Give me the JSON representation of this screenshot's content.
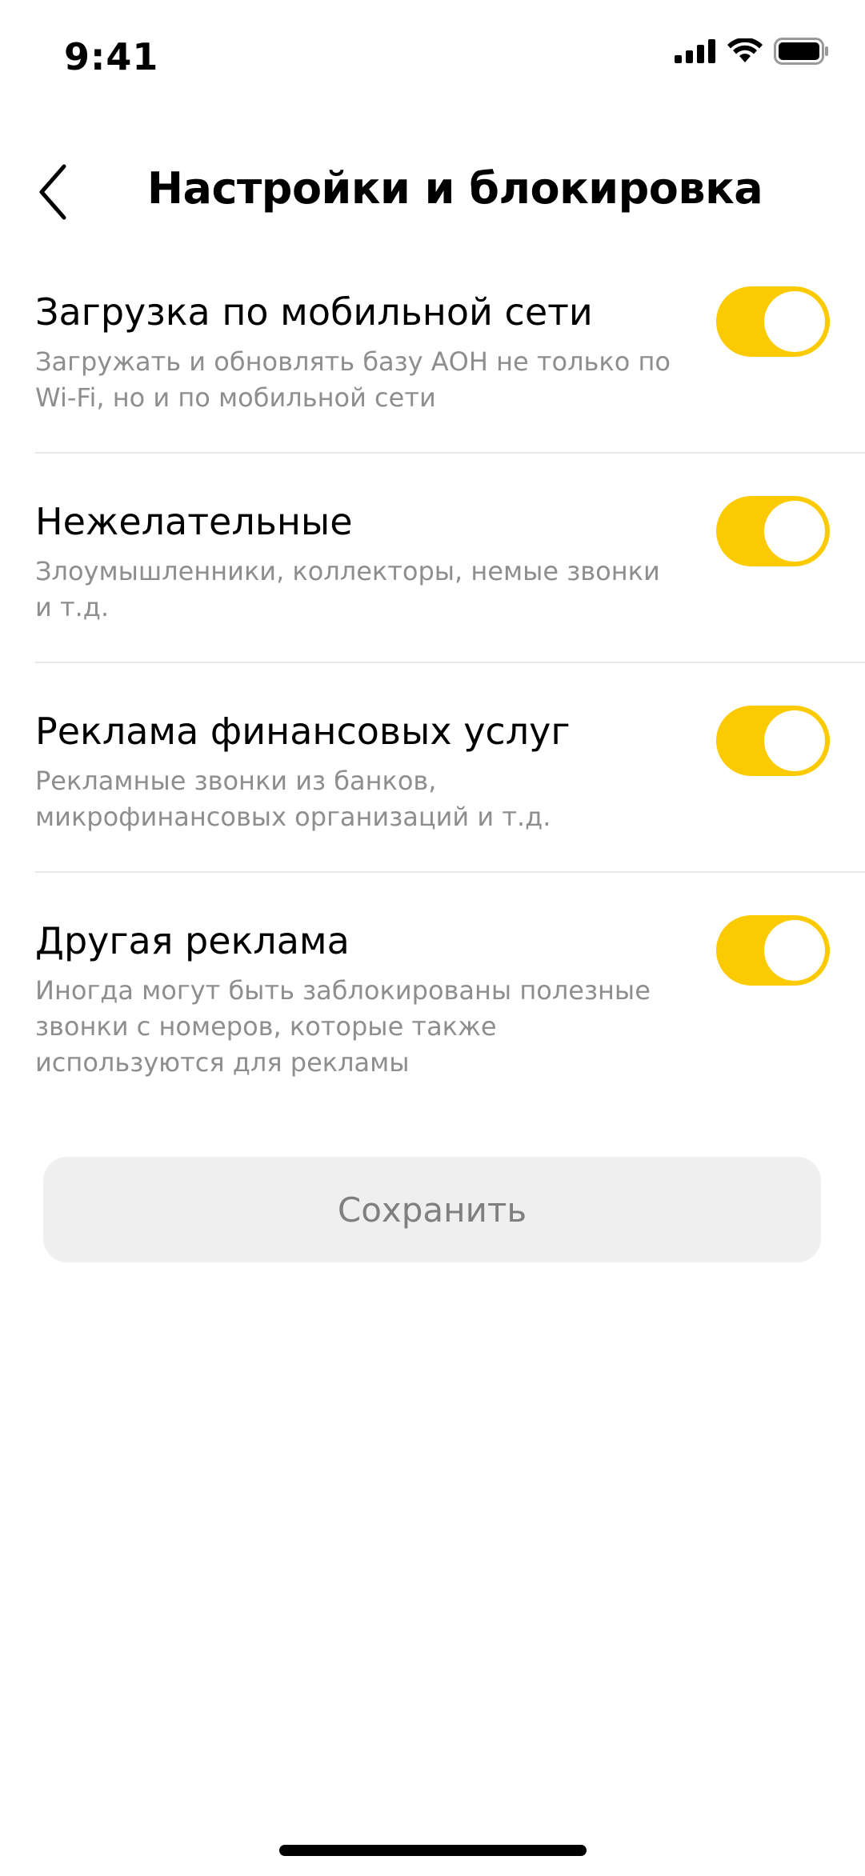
{
  "status_bar": {
    "time": "9:41",
    "icons": [
      "signal-icon",
      "wifi-icon",
      "battery-icon"
    ]
  },
  "header": {
    "back_icon": "chevron-left-icon",
    "title": "Настройки и блокировка"
  },
  "settings": [
    {
      "title": "Загрузка по мобильной сети",
      "description": "Загружать и обновлять базу АОН не только по Wi-Fi, но и по мобильной сети",
      "enabled": true
    },
    {
      "title": "Нежелательные",
      "description": "Злоумышленники, коллекторы, немые звонки и т.д.",
      "enabled": true
    },
    {
      "title": "Реклама финансовых услуг",
      "description": "Рекламные звонки из банков, микрофинансовых организаций и т.д.",
      "enabled": true
    },
    {
      "title": "Другая реклама",
      "description": "Иногда могут быть заблокированы полезные звонки с номеров, которые также используются для рекламы",
      "enabled": true
    }
  ],
  "save_button": {
    "label": "Сохранить"
  },
  "colors": {
    "toggle_on": "#fcca00",
    "description_text": "#8e8e8e",
    "button_bg": "#efefef",
    "button_text": "#7f7f7f"
  }
}
